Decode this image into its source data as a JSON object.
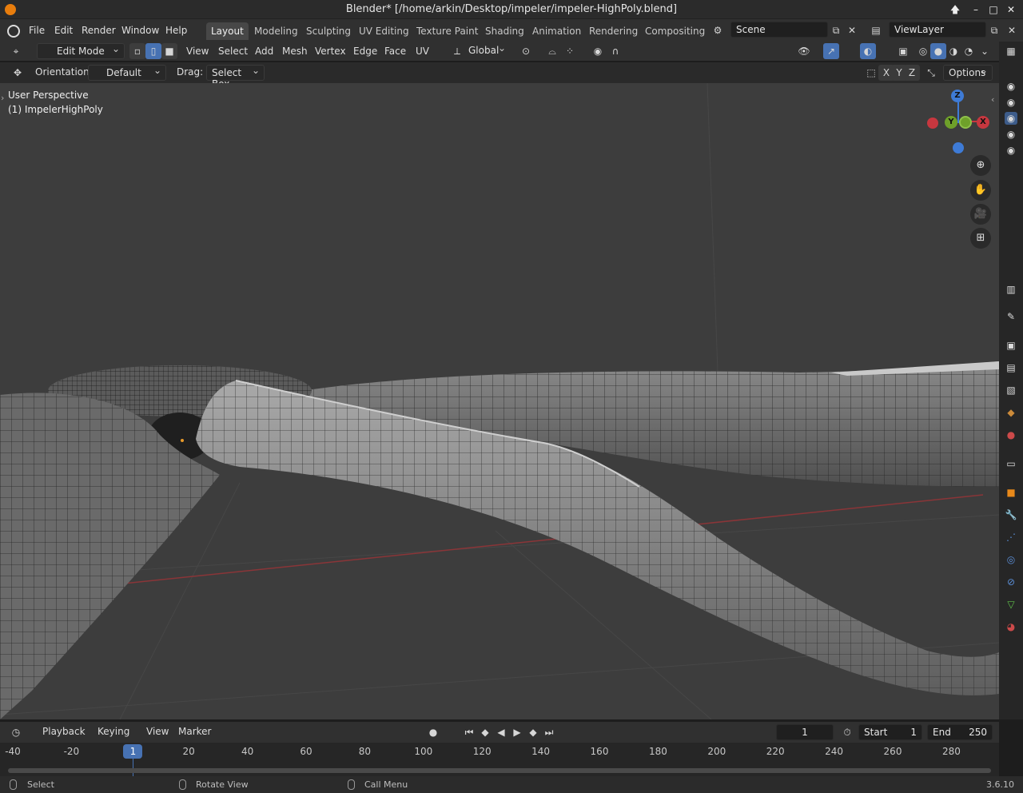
{
  "window": {
    "title": "Blender* [/home/arkin/Desktop/impeler/impeler-HighPoly.blend]",
    "controls": {
      "up": "🡅",
      "minimize": "–",
      "maximize": "□",
      "close": "✕"
    }
  },
  "menubar": {
    "items": [
      "File",
      "Edit",
      "Render",
      "Window",
      "Help"
    ],
    "workspaces": [
      "Layout",
      "Modeling",
      "Sculpting",
      "UV Editing",
      "Texture Paint",
      "Shading",
      "Animation",
      "Rendering",
      "Compositing"
    ],
    "active_workspace": "Layout",
    "scene": "Scene",
    "view_layer": "ViewLayer"
  },
  "header3d": {
    "mode": "Edit Mode",
    "menus": [
      "View",
      "Select",
      "Add",
      "Mesh",
      "Vertex",
      "Edge",
      "Face",
      "UV"
    ],
    "transform_orientation": "Global"
  },
  "toolheader": {
    "orientation_label": "Orientation:",
    "orientation_value": "Default",
    "drag_label": "Drag:",
    "drag_value": "Select Box",
    "axes": [
      "X",
      "Y",
      "Z"
    ],
    "options": "Options"
  },
  "viewport": {
    "view_name": "User Perspective",
    "object_name": "(1) ImpelerHighPoly",
    "gizmo": {
      "z": "Z",
      "y": "Y",
      "x": "X"
    },
    "accent_x": "#c7373f",
    "accent_y": "#6ea02a",
    "accent_z": "#3e7bd6"
  },
  "timeline": {
    "menus": [
      "Playback",
      "Keying",
      "View",
      "Marker"
    ],
    "current_frame": "1",
    "start_label": "Start",
    "start": "1",
    "end_label": "End",
    "end": "250",
    "ticks": [
      "-40",
      "-20",
      "1",
      "20",
      "40",
      "60",
      "80",
      "100",
      "120",
      "140",
      "160",
      "180",
      "200",
      "220",
      "240",
      "260",
      "280"
    ]
  },
  "statusbar": {
    "select": "Select",
    "rotate": "Rotate View",
    "call_menu": "Call Menu",
    "version": "3.6.10"
  }
}
